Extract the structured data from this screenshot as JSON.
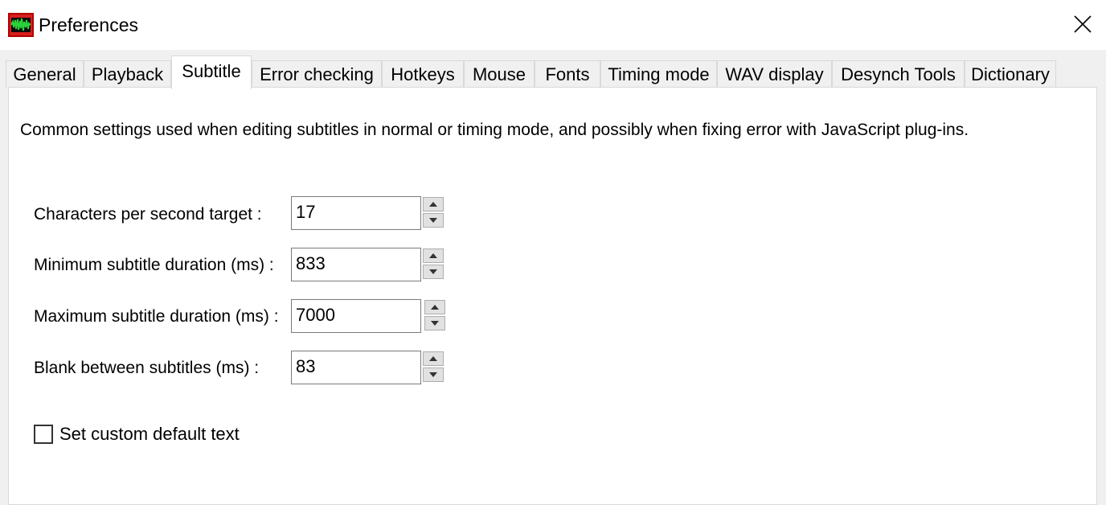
{
  "window": {
    "title": "Preferences",
    "app_icon": "subtitle-workshop-waveform-icon",
    "close_icon": "close-icon"
  },
  "tabs": [
    {
      "label": "General",
      "active": false
    },
    {
      "label": "Playback",
      "active": false
    },
    {
      "label": "Subtitle",
      "active": true
    },
    {
      "label": "Error checking",
      "active": false
    },
    {
      "label": "Hotkeys",
      "active": false
    },
    {
      "label": "Mouse",
      "active": false
    },
    {
      "label": "Fonts",
      "active": false
    },
    {
      "label": "Timing mode",
      "active": false
    },
    {
      "label": "WAV display",
      "active": false
    },
    {
      "label": "Desynch Tools",
      "active": false
    },
    {
      "label": "Dictionary",
      "active": false
    }
  ],
  "subtitle_panel": {
    "description": "Common settings used when editing subtitles in normal or timing mode, and possibly when fixing error with JavaScript plug-ins.",
    "fields": [
      {
        "label": "Characters per second target :",
        "value": "17"
      },
      {
        "label": "Minimum subtitle duration (ms) :",
        "value": "833"
      },
      {
        "label": "Maximum subtitle duration (ms) :",
        "value": "7000"
      },
      {
        "label": "Blank between subtitles (ms) :",
        "value": "83"
      }
    ],
    "custom_default_text": {
      "label": "Set custom default text",
      "checked": false
    }
  },
  "colors": {
    "window_bg": "#f0f0f0",
    "panel_bg": "#ffffff",
    "icon_red": "#d81e1e",
    "icon_green": "#2bd13a"
  }
}
